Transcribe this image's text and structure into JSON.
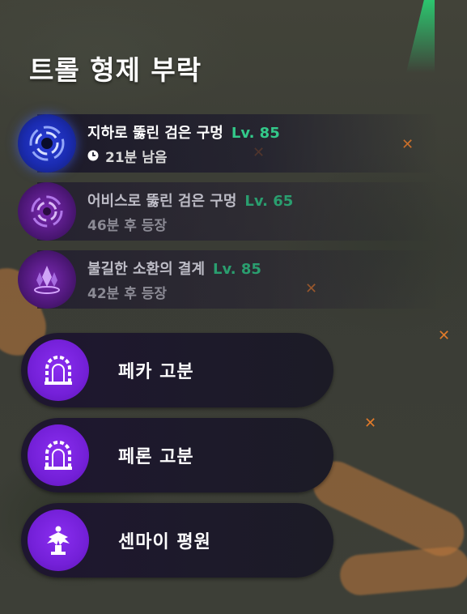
{
  "panel": {
    "title": "트롤 형제 부락"
  },
  "events": [
    {
      "name": "지하로 뚫린 검은 구멍",
      "level": "Lv. 85",
      "status": "21분 남음",
      "icon": "black-hole-vortex-icon",
      "active": true
    },
    {
      "name": "어비스로 뚫린 검은 구멍",
      "level": "Lv. 65",
      "status": "46분 후 등장",
      "icon": "abyss-vortex-icon",
      "active": false
    },
    {
      "name": "불길한 소환의 결계",
      "level": "Lv. 85",
      "status": "42분 후 등장",
      "icon": "summoning-crystal-icon",
      "active": false
    }
  ],
  "destinations": [
    {
      "label": "페카 고분",
      "icon": "tomb-gate-icon"
    },
    {
      "label": "페론 고분",
      "icon": "tomb-gate-icon"
    },
    {
      "label": "센마이 평원",
      "icon": "winged-statue-icon"
    }
  ],
  "colors": {
    "level_green": "#33c98a",
    "destination_icon_purple": "#7420d8",
    "active_icon_blue": "#1a2bb0"
  }
}
